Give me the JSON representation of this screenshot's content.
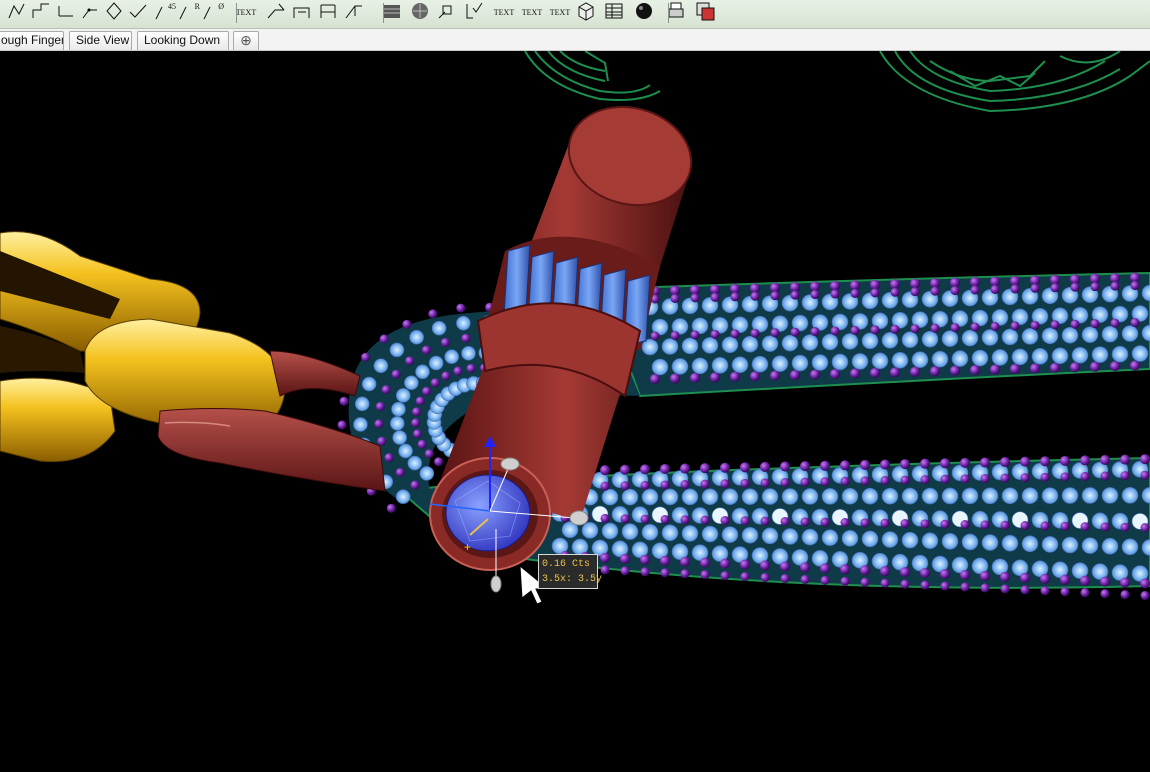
{
  "toolbar": {
    "buttons": [
      {
        "name": "polyline-tool-icon"
      },
      {
        "name": "polyline-steps-tool-icon"
      },
      {
        "name": "line-tool-icon"
      },
      {
        "name": "corner-tool-icon"
      },
      {
        "name": "diamond-tool-icon"
      },
      {
        "name": "check-line-tool-icon"
      },
      {
        "name": "angle-45-tool-icon",
        "label": "45"
      },
      {
        "name": "radius-tool-icon",
        "label": "R"
      },
      {
        "name": "diameter-tool-icon",
        "label": "Ø"
      },
      {
        "name": "text-tool-icon",
        "label": "TEXT"
      },
      {
        "name": "leader-tool-icon"
      },
      {
        "name": "dimension-tool-icon"
      },
      {
        "name": "bracket-tool-icon"
      },
      {
        "name": "arrow-dimension-tool-icon"
      },
      {
        "name": "hatch-tool-icon"
      },
      {
        "name": "hatch-circle-tool-icon"
      },
      {
        "name": "note-tool-icon"
      },
      {
        "name": "check-note-tool-icon"
      },
      {
        "name": "text-label-icon",
        "label": "TEXT"
      },
      {
        "name": "text-italic-icon",
        "label": "TEXT"
      },
      {
        "name": "text-stacked-icon",
        "label": "TEXT"
      },
      {
        "name": "cube-icon"
      },
      {
        "name": "table-icon"
      },
      {
        "name": "sphere-icon"
      },
      {
        "name": "print-icon"
      },
      {
        "name": "render-window-icon"
      }
    ]
  },
  "tabs": [
    {
      "label": "ough Finger"
    },
    {
      "label": "Side View"
    },
    {
      "label": "Looking Down"
    }
  ],
  "add_tab_icon": "plus-icon",
  "tooltip": {
    "line1": "0.16  Cts",
    "line2": "3.5x: 3.5y"
  },
  "colors": {
    "viewport_bg": "#000000",
    "gold": "#e8b21a",
    "maroon": "#8e2a28",
    "sapphire": "#5062e8",
    "stone_light": "#7fb4ee",
    "prong_purple": "#5a1a8a",
    "green_wire": "#1e8f4e"
  }
}
